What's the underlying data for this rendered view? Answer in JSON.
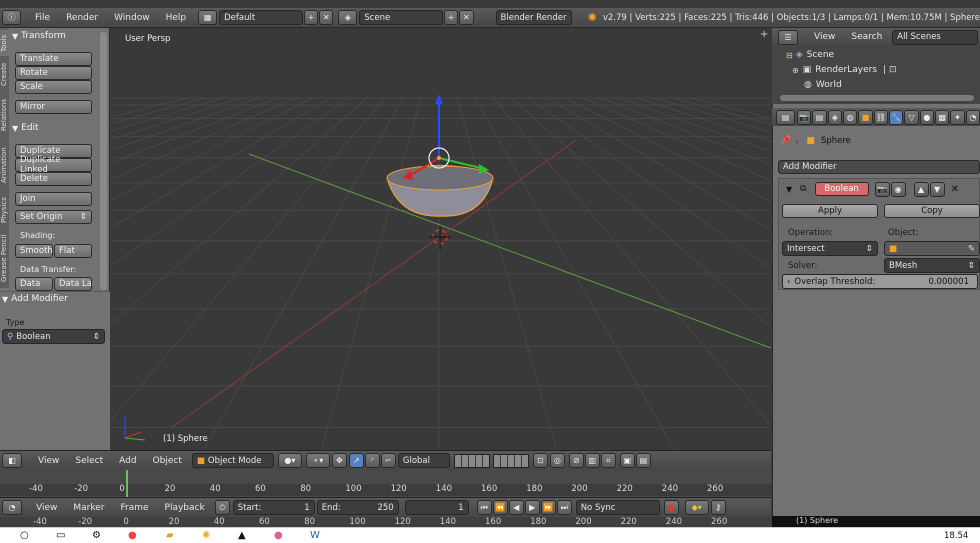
{
  "topbar": {
    "menus": [
      "File",
      "Render",
      "Window",
      "Help"
    ],
    "layout": "Default",
    "scene": "Scene",
    "engine": "Blender Render",
    "stats": "v2.79 | Verts:225 | Faces:225 | Tris:446 | Objects:1/3 | Lamps:0/1 | Mem:10.75M | Sphere"
  },
  "tool_tabs": [
    "Tools",
    "Create",
    "Relations",
    "Animation",
    "Physics",
    "Grease Pencil"
  ],
  "tools": {
    "transform_title": "Transform",
    "translate": "Translate",
    "rotate": "Rotate",
    "scale": "Scale",
    "mirror": "Mirror",
    "edit_title": "Edit",
    "duplicate": "Duplicate",
    "duplicate_linked": "Duplicate Linked",
    "delete": "Delete",
    "join": "Join",
    "set_origin": "Set Origin",
    "shading_label": "Shading:",
    "smooth": "Smooth",
    "flat": "Flat",
    "data_transfer_label": "Data Transfer:",
    "data": "Data",
    "data_layout": "Data La"
  },
  "operator_panel": {
    "title": "Add Modifier",
    "type_label": "Type",
    "type_value": "Boolean"
  },
  "viewport": {
    "view_label": "User Persp",
    "object_label": "(1) Sphere"
  },
  "view3d_header": {
    "menus": [
      "View",
      "Select",
      "Add",
      "Object"
    ],
    "mode": "Object Mode",
    "orientation": "Global"
  },
  "timeline": {
    "ticks": [
      "-40",
      "-20",
      "0",
      "20",
      "40",
      "60",
      "80",
      "100",
      "120",
      "140",
      "160",
      "180",
      "200",
      "220",
      "240",
      "260"
    ],
    "menus": [
      "View",
      "Marker",
      "Frame",
      "Playback"
    ],
    "start_label": "Start:",
    "start_value": "1",
    "end_label": "End:",
    "end_value": "250",
    "current_frame": "1",
    "sync": "No Sync"
  },
  "outliner": {
    "menus": [
      "View",
      "Search"
    ],
    "filter": "All Scenes",
    "items": [
      "Scene",
      "RenderLayers",
      "World"
    ]
  },
  "properties": {
    "object_name": "Sphere",
    "add_modifier": "Add Modifier",
    "modifier_name": "Boolean",
    "apply": "Apply",
    "copy": "Copy",
    "operation_label": "Operation:",
    "object_label": "Object:",
    "operation_value": "Intersect",
    "solver_label": "Solver:",
    "solver_value": "BMesh",
    "threshold_label": "Overlap Threshold:",
    "threshold_value": "0.000001"
  },
  "status_right": "(1) Sphere",
  "taskbar": {
    "time": "18.54"
  }
}
